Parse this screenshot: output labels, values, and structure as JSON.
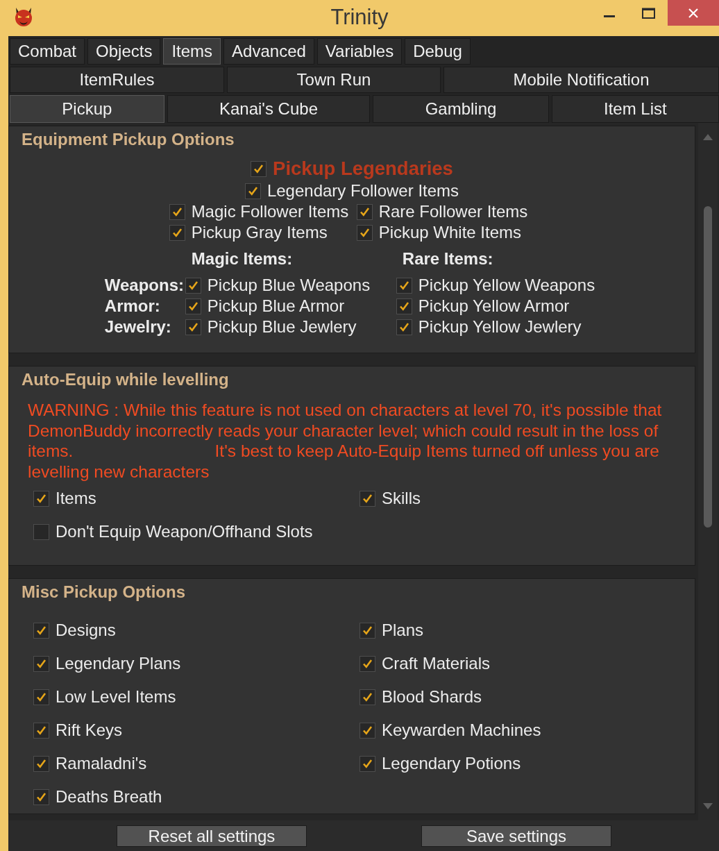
{
  "window": {
    "title": "Trinity"
  },
  "tab_rows": [
    {
      "stretched": false,
      "tabs": [
        {
          "label": "Combat",
          "selected": false
        },
        {
          "label": "Objects",
          "selected": false
        },
        {
          "label": "Items",
          "selected": true
        },
        {
          "label": "Advanced",
          "selected": false
        },
        {
          "label": "Variables",
          "selected": false
        },
        {
          "label": "Debug",
          "selected": false
        }
      ]
    },
    {
      "stretched": true,
      "tabs": [
        {
          "label": "ItemRules",
          "selected": false
        },
        {
          "label": "Town Run",
          "selected": false
        },
        {
          "label": "Mobile Notification",
          "selected": false
        }
      ]
    },
    {
      "stretched": true,
      "tabs": [
        {
          "label": "Pickup",
          "selected": true
        },
        {
          "label": "Kanai's Cube",
          "selected": false
        },
        {
          "label": "Gambling",
          "selected": false
        },
        {
          "label": "Item List",
          "selected": false
        }
      ]
    }
  ],
  "equipment_pickup": {
    "title": "Equipment Pickup Options",
    "legendaries": {
      "label": "Pickup Legendaries",
      "checked": true
    },
    "legendary_follower": {
      "label": "Legendary Follower Items",
      "checked": true
    },
    "pairs": [
      {
        "options": [
          {
            "label": "Magic Follower Items",
            "checked": true
          },
          {
            "label": "Rare Follower Items",
            "checked": true
          }
        ]
      },
      {
        "options": [
          {
            "label": "Pickup Gray Items",
            "checked": true
          },
          {
            "label": "Pickup White Items",
            "checked": true
          }
        ]
      }
    ],
    "columns": [
      "Magic Items:",
      "Rare Items:"
    ],
    "rows": [
      {
        "label": "Weapons:",
        "options": [
          {
            "label": "Pickup Blue Weapons",
            "checked": true
          },
          {
            "label": "Pickup Yellow Weapons",
            "checked": true
          }
        ]
      },
      {
        "label": "Armor:",
        "options": [
          {
            "label": "Pickup Blue Armor",
            "checked": true
          },
          {
            "label": "Pickup Yellow Armor",
            "checked": true
          }
        ]
      },
      {
        "label": "Jewelry:",
        "options": [
          {
            "label": "Pickup Blue Jewlery",
            "checked": true
          },
          {
            "label": "Pickup Yellow Jewlery",
            "checked": true
          }
        ]
      }
    ]
  },
  "auto_equip": {
    "title": "Auto-Equip while levelling",
    "warning": "WARNING : While this feature is not used on characters at level 70, it's possible that DemonBuddy incorrectly reads your character level; which could result in the loss of items.                              It's best to keep Auto-Equip Items turned off unless you are levelling new characters",
    "options": [
      {
        "label": "Items",
        "checked": true
      },
      {
        "label": "Skills",
        "checked": true
      },
      {
        "label": "Don't Equip Weapon/Offhand Slots",
        "checked": false
      }
    ]
  },
  "misc_pickup": {
    "title": "Misc Pickup Options",
    "options": [
      {
        "label": "Designs",
        "checked": true
      },
      {
        "label": "Plans",
        "checked": true
      },
      {
        "label": "Legendary Plans",
        "checked": true
      },
      {
        "label": "Craft Materials",
        "checked": true
      },
      {
        "label": "Low Level Items",
        "checked": true
      },
      {
        "label": "Blood Shards",
        "checked": true
      },
      {
        "label": "Rift Keys",
        "checked": true
      },
      {
        "label": "Keywarden Machines",
        "checked": true
      },
      {
        "label": "Ramaladni's",
        "checked": true
      },
      {
        "label": "Legendary Potions",
        "checked": true
      },
      {
        "label": "Deaths Breath",
        "checked": true
      }
    ]
  },
  "buttons": [
    "Reset all settings",
    "Save settings"
  ]
}
